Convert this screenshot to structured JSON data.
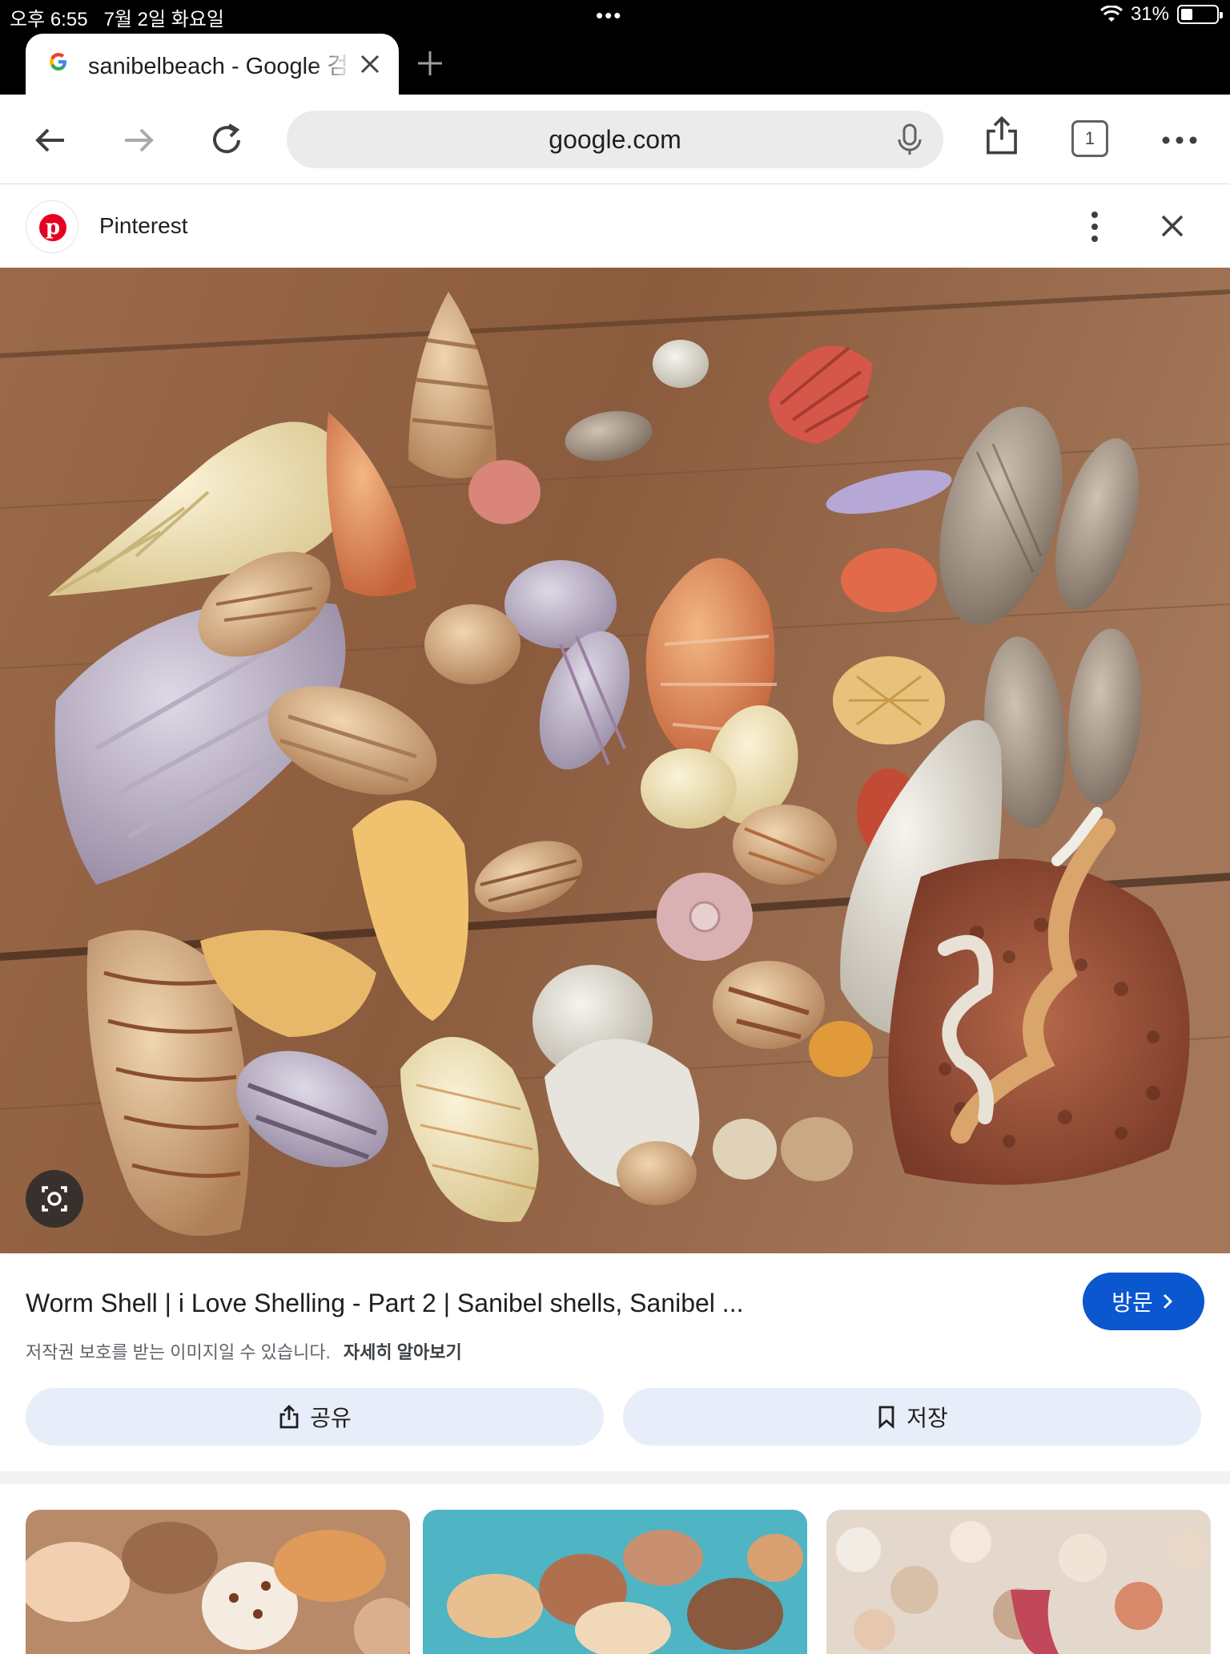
{
  "status_bar": {
    "time": "오후 6:55",
    "date": "7월 2일 화요일",
    "center_dots": "•••",
    "battery_percent": "31%",
    "battery_level": 0.31
  },
  "tab": {
    "title": "sanibelbeach - Google 검색",
    "favicon": "G"
  },
  "toolbar": {
    "url": "google.com",
    "tab_count": "1"
  },
  "source": {
    "name": "Pinterest",
    "logo_letter": "p"
  },
  "result": {
    "title": "Worm Shell | i Love Shelling - Part 2 | Sanibel shells, Sanibel ...",
    "visit_label": "방문",
    "copyright_notice": "저작권 보호를 받는 이미지일 수 있습니다.",
    "learn_more": "자세히 알아보기",
    "share_label": "공유",
    "save_label": "저장"
  },
  "colors": {
    "accent_blue": "#0b57d0",
    "action_button_bg": "#e8eef9",
    "pinterest_red": "#e60023",
    "status_bar_bg": "#000000"
  },
  "icons": [
    "back-arrow-icon",
    "forward-arrow-icon",
    "reload-icon",
    "mic-icon",
    "share-icon",
    "tabs-icon",
    "more-icon",
    "kebab-icon",
    "close-icon",
    "lens-icon",
    "chevron-right-icon",
    "bookmark-icon",
    "wifi-icon",
    "battery-icon"
  ]
}
